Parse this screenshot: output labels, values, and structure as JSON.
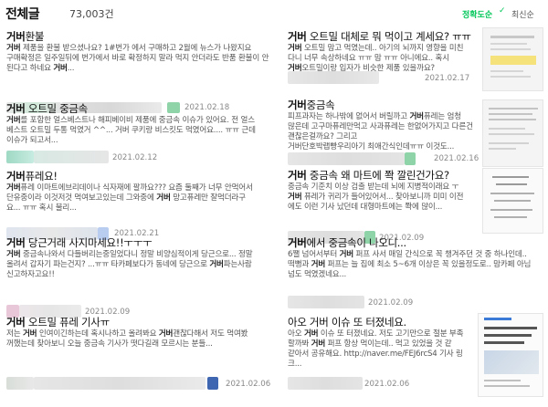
{
  "header": {
    "title": "전체글",
    "count": "73,003건",
    "sort_accuracy": "정확도순",
    "sort_check": "✓",
    "sort_latest": "최신순"
  },
  "posts": [
    {
      "title_bold": "거버",
      "title_rest": "환불",
      "lines": [
        [
          "",
          "거버",
          " 제품을 환불 받으셨나요? 1#번가 에서 구매하고 2월에 뉴스가 나왔지요"
        ],
        [
          "",
          "",
          "구매확정은 일주일뒤에 번가에서 바로 확정하지 말라 먹지 안더라도 반품 환불이 안"
        ],
        [
          "",
          "",
          "된다고 하네요 "
        ],
        [
          "",
          "거버",
          "..."
        ]
      ],
      "date": "2021.02.18"
    },
    {
      "title_bold": "거버",
      "title_rest": " 오트밀 중금속",
      "lines": [
        [
          "",
          "거버",
          "를 포함한 얼스베스트나 해피베이비 제품에 중금속 이슈가 있어요. 전 얼스"
        ],
        [
          "",
          "",
          "베스트 오트밀 두통 먹였거 ^^... 거버 쿠키랑 비스킷도 먹였어요.... ㅠㅠ 근데"
        ],
        [
          "",
          "",
          "이슈가 되고서..."
        ]
      ],
      "date": "2021.02.12"
    },
    {
      "title_bold": "거버",
      "title_rest": "퓨레요!",
      "lines": [
        [
          "",
          "거버",
          "퓨레 이마트에브리데이나 식자재에 팔까요??? 요즘 둘째가 너무 안먹어서"
        ],
        [
          "",
          "",
          "단유중이라 이것저것 먹여보고있는데 그와중에 "
        ],
        [
          "",
          "거버",
          " 망고퓨레만 잘먹더라구"
        ],
        [
          "",
          "",
          "요... ㅠㅠ 혹시 불리..."
        ]
      ],
      "date": "2021.02.21"
    },
    {
      "title_bold": "거버",
      "title_rest": " 당근거래 사지마세요!!ㅜㅜㅜ",
      "lines": [
        [
          "",
          "거버",
          " 중금속나와서 다들버리는중일었다니 정말 비양심적이게 당근으로... 정말"
        ],
        [
          "",
          "",
          "올려서 갑자기 파는건지? ...ㅠㅠ 타카페보다가 동네에 당근으로 "
        ],
        [
          "",
          "거버",
          "파는사람"
        ],
        [
          "",
          "",
          "신고하자고요!!"
        ]
      ],
      "date": "2021.02.09"
    },
    {
      "title_bold": "거버",
      "title_rest": " 오트밀 퓨레 기사ㅠ",
      "lines": [
        [
          "",
          "",
          "저는 "
        ],
        [
          "",
          "거버",
          " 인여이긴하는데 혹시나하고 올려봐요 "
        ],
        [
          "",
          "거버",
          "괜찮다해서 저도 먹여봤"
        ],
        [
          "",
          "",
          "꺼했는데 찾아보니 오늘 중금속 기사가 떳다길래 모르시는 분들..."
        ]
      ],
      "date": "2021.02.06"
    },
    {
      "title_bold": "거버",
      "title_rest": " 오트밀 대체로 뭐 먹이고 계세요? ㅠㅠ",
      "lines": [
        [
          "",
          "거버",
          " 오트밀 맘고 먹였는데.. 아기의 뇌까지 영향을 미친"
        ],
        [
          "",
          "",
          "다니 너무 속상하네요 ㅠㅠ 맘 ㅠㅠ 아니에요.. 혹시"
        ],
        [
          "",
          "거버",
          "오트밀이랑 입자가 비슷한 제품 있을까요?"
        ]
      ],
      "date": "2021.02.17"
    },
    {
      "title_bold": "거버",
      "title_rest": "중금속",
      "lines": [
        [
          "",
          "",
          "피프과자는 하나밖에 없어서 버릴까고 "
        ],
        [
          "",
          "거버",
          "퓨레는 엄청"
        ],
        [
          "",
          "",
          "많은데 고구마퓨레만먹고 사과퓨레는 한없어가지고 다른건괜찮은걸까요? 그리고"
        ],
        [
          "",
          "",
          "거버단호박랩빵우리아기 최애간식인데ㅠㅠ 이것도..."
        ]
      ],
      "date": "2021.02.16"
    },
    {
      "title_bold": "거버",
      "title_rest": " 중금속 왜 마트에 쫙 깔린건가요?",
      "lines": [
        [
          "",
          "",
          "중금속 기준치 이상 검출 받는데 뇌에 지병적이래요 ㅜ"
        ],
        [
          "",
          "거버",
          " 퓨레가 귀리가 들어있어서... 찾아보니까 미미 이전"
        ],
        [
          "",
          "",
          "에도 이런 기사 났던데 대형마트에는 쫙에 많이..."
        ]
      ],
      "date": "2021.02.09"
    },
    {
      "title_bold": "거버",
      "title_rest": "에서 중금속이 나오니...",
      "lines": [
        [
          "",
          "",
          "6쨀 넘어서부터 "
        ],
        [
          "",
          "거버",
          " 퍼프 사서 매일 간식으로 꼭 챙겨주던 것 중 하나인데.."
        ],
        [
          "",
          "",
          "떡뻥과 "
        ],
        [
          "",
          "거버",
          " 퍼프는 늘 집에 최소 5~6개 이상은 꼭 있을정도로.. 맘카페 아님"
        ],
        [
          "",
          "",
          "넘도 먹였겠네요..."
        ]
      ],
      "date": "2021.02.09"
    },
    {
      "title_bold": "",
      "title_rest": "아오 거버 이슈 또 터졌네요.",
      "lines": [
        [
          "",
          "",
          "아오 "
        ],
        [
          "",
          "거버",
          " 이슈 또 터졌네요. 저도 고기만으로 절분 부족"
        ],
        [
          "",
          "",
          "할까봐 "
        ],
        [
          "",
          "거버",
          " 퍼프 항상 먹이는데.. 먹고 있었을 것 같"
        ],
        [
          "",
          "",
          "같아서 공유해요. http://naver.me/FEJ6rcS4 기사 링크..."
        ]
      ],
      "date": "2021.02.06"
    }
  ],
  "colors": {
    "accent": "#03c75a",
    "blur_green": "#8fd3a8",
    "blur_gray": "#d9d9d9",
    "blur_pink": "#e8c8d8",
    "blur_blue": "#b8cdf0"
  }
}
